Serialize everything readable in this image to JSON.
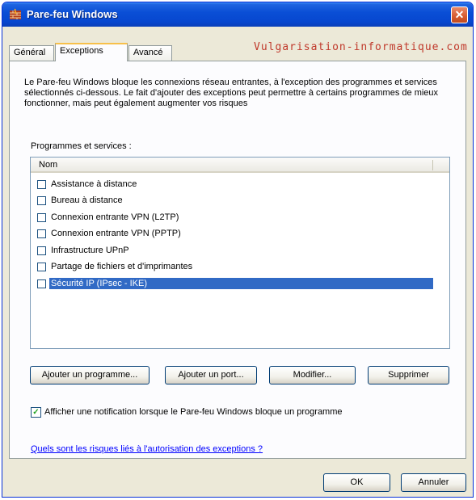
{
  "window": {
    "title": "Pare-feu Windows",
    "close_symbol": "✕"
  },
  "tabs": [
    {
      "label": "Général"
    },
    {
      "label": "Exceptions"
    },
    {
      "label": "Avancé"
    }
  ],
  "watermark": "Vulgarisation-informatique.com",
  "description": "Le Pare-feu Windows bloque les connexions réseau entrantes, à l'exception des programmes et services sélectionnés ci-dessous. Le fait d'ajouter des exceptions peut permettre à certains programmes de mieux fonctionner, mais peut également augmenter vos risques",
  "list": {
    "section_label": "Programmes et services :",
    "column_header": "Nom",
    "items": [
      {
        "label": "Assistance à distance",
        "checked": false
      },
      {
        "label": "Bureau à distance",
        "checked": false
      },
      {
        "label": "Connexion entrante VPN (L2TP)",
        "checked": false
      },
      {
        "label": "Connexion entrante VPN (PPTP)",
        "checked": false
      },
      {
        "label": "Infrastructure UPnP",
        "checked": false
      },
      {
        "label": "Partage de fichiers et d'imprimantes",
        "checked": false
      },
      {
        "label": "Sécurité IP (IPsec - IKE)",
        "checked": false,
        "selected": true
      }
    ]
  },
  "buttons": {
    "add_program": "Ajouter un programme...",
    "add_port": "Ajouter un port...",
    "modify": "Modifier...",
    "delete": "Supprimer",
    "ok": "OK",
    "cancel": "Annuler"
  },
  "notify": {
    "label": "Afficher une notification lorsque le Pare-feu Windows bloque un programme",
    "checked": true,
    "check_symbol": "✓"
  },
  "risk_link": "Quels sont les risques liés à l'autorisation des exceptions ?",
  "colors": {
    "selection": "#316ac5",
    "titlebar": "#0747cf",
    "watermark": "#c0392b",
    "link": "#0000ff"
  }
}
